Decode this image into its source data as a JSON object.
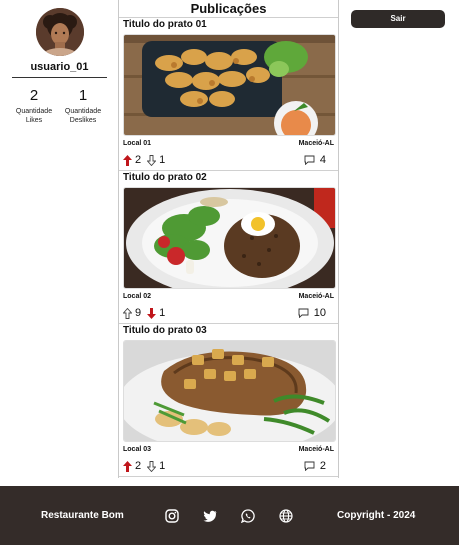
{
  "profile": {
    "username": "usuario_01",
    "likes_count": "2",
    "likes_label_1": "Quantidade",
    "likes_label_2": "Likes",
    "dislikes_count": "1",
    "dislikes_label_1": "Quantidade",
    "dislikes_label_2": "Deslikes"
  },
  "feed": {
    "title": "Publicações",
    "posts": [
      {
        "title": "Titulo do prato 01",
        "local": "Local 01",
        "city": "Maceió-AL",
        "upvotes": "2",
        "downvotes": "1",
        "comments": "4",
        "upvoted": true,
        "downvoted": false
      },
      {
        "title": "Titulo do prato 02",
        "local": "Local 02",
        "city": "Maceió-AL",
        "upvotes": "9",
        "downvotes": "1",
        "comments": "10",
        "upvoted": false,
        "downvoted": true
      },
      {
        "title": "Titulo do prato 03",
        "local": "Local 03",
        "city": "Maceió-AL",
        "upvotes": "2",
        "downvotes": "1",
        "comments": "2",
        "upvoted": true,
        "downvoted": false
      }
    ]
  },
  "header": {
    "logout_label": "Sair"
  },
  "footer": {
    "brand": "Restaurante Bom",
    "copyright": "Copyright - 2024",
    "social_icons": [
      "instagram-icon",
      "twitter-icon",
      "whatsapp-icon",
      "globe-icon"
    ]
  },
  "colors": {
    "vote_active": "#c0161b",
    "footer_bg": "#342c29",
    "button_bg": "#2f2a28"
  }
}
